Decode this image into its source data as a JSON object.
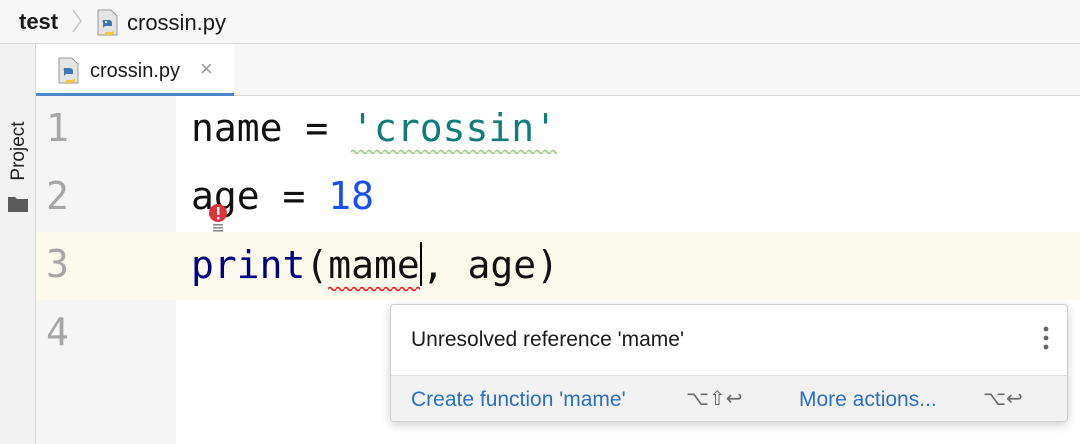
{
  "breadcrumb": {
    "project": "test",
    "file": "crossin.py",
    "file_icon": "python-file-icon"
  },
  "toolwindow": {
    "project_label": "Project",
    "icon": "folder-icon"
  },
  "tabs": [
    {
      "label": "crossin.py",
      "icon": "python-file-icon",
      "close": "×",
      "active": true
    }
  ],
  "editor": {
    "lines": [
      {
        "number": "1",
        "tokens": [
          "name = ",
          "'crossin'"
        ]
      },
      {
        "number": "2",
        "tokens": [
          "age",
          " = ",
          "18"
        ]
      },
      {
        "number": "3",
        "tokens": [
          "print",
          "(",
          "mame",
          ", age)"
        ]
      },
      {
        "number": "4",
        "tokens": []
      }
    ],
    "current_line": 3,
    "colors": {
      "string": "#0f7d7a",
      "number": "#1750eb",
      "keyword": "#000080",
      "error": "#e8262b"
    }
  },
  "popup": {
    "message": "Unresolved reference 'mame'",
    "menu_icon": "more-vertical-icon",
    "actions": [
      {
        "label": "Create function 'mame'",
        "shortcut": "⌥⇧↩"
      },
      {
        "label": "More actions...",
        "shortcut": "⌥↩"
      }
    ]
  }
}
